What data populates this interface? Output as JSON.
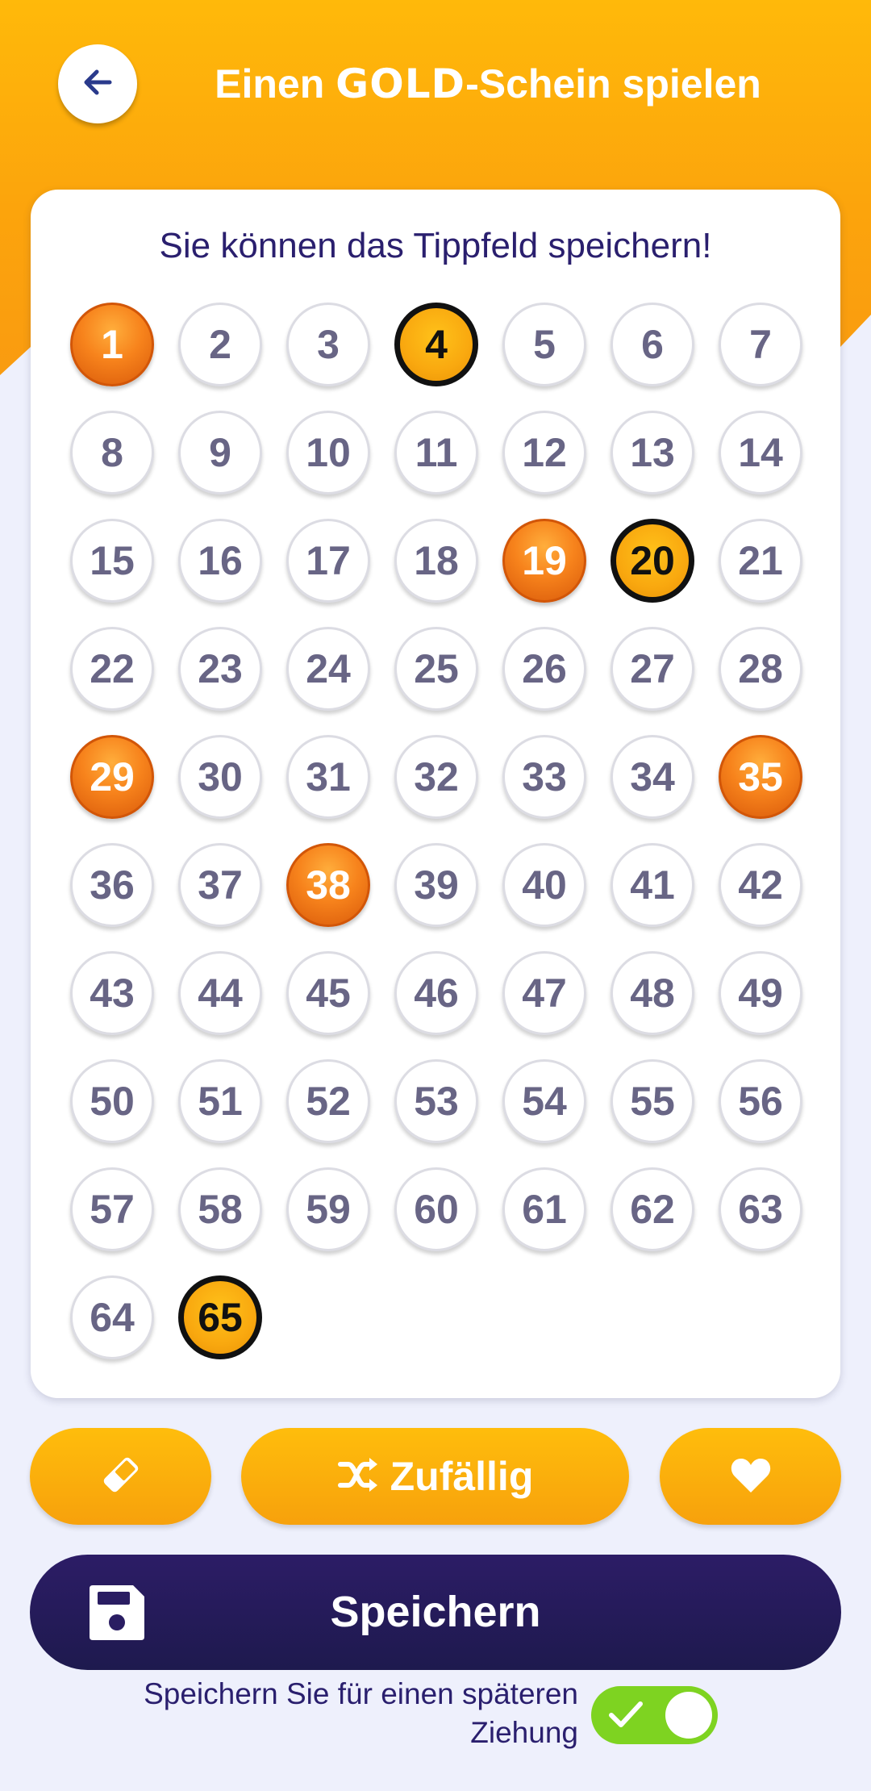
{
  "header": {
    "title_prefix": "Einen ",
    "title_brand": "GOLD",
    "title_suffix": "-Schein spielen"
  },
  "card": {
    "hint": "Sie können das Tippfeld speichern!",
    "numbers": [
      {
        "n": "1",
        "state": "orange"
      },
      {
        "n": "2",
        "state": "plain"
      },
      {
        "n": "3",
        "state": "plain"
      },
      {
        "n": "4",
        "state": "gold"
      },
      {
        "n": "5",
        "state": "plain"
      },
      {
        "n": "6",
        "state": "plain"
      },
      {
        "n": "7",
        "state": "plain"
      },
      {
        "n": "8",
        "state": "plain"
      },
      {
        "n": "9",
        "state": "plain"
      },
      {
        "n": "10",
        "state": "plain"
      },
      {
        "n": "11",
        "state": "plain"
      },
      {
        "n": "12",
        "state": "plain"
      },
      {
        "n": "13",
        "state": "plain"
      },
      {
        "n": "14",
        "state": "plain"
      },
      {
        "n": "15",
        "state": "plain"
      },
      {
        "n": "16",
        "state": "plain"
      },
      {
        "n": "17",
        "state": "plain"
      },
      {
        "n": "18",
        "state": "plain"
      },
      {
        "n": "19",
        "state": "orange"
      },
      {
        "n": "20",
        "state": "gold"
      },
      {
        "n": "21",
        "state": "plain"
      },
      {
        "n": "22",
        "state": "plain"
      },
      {
        "n": "23",
        "state": "plain"
      },
      {
        "n": "24",
        "state": "plain"
      },
      {
        "n": "25",
        "state": "plain"
      },
      {
        "n": "26",
        "state": "plain"
      },
      {
        "n": "27",
        "state": "plain"
      },
      {
        "n": "28",
        "state": "plain"
      },
      {
        "n": "29",
        "state": "orange"
      },
      {
        "n": "30",
        "state": "plain"
      },
      {
        "n": "31",
        "state": "plain"
      },
      {
        "n": "32",
        "state": "plain"
      },
      {
        "n": "33",
        "state": "plain"
      },
      {
        "n": "34",
        "state": "plain"
      },
      {
        "n": "35",
        "state": "orange"
      },
      {
        "n": "36",
        "state": "plain"
      },
      {
        "n": "37",
        "state": "plain"
      },
      {
        "n": "38",
        "state": "orange"
      },
      {
        "n": "39",
        "state": "plain"
      },
      {
        "n": "40",
        "state": "plain"
      },
      {
        "n": "41",
        "state": "plain"
      },
      {
        "n": "42",
        "state": "plain"
      },
      {
        "n": "43",
        "state": "plain"
      },
      {
        "n": "44",
        "state": "plain"
      },
      {
        "n": "45",
        "state": "plain"
      },
      {
        "n": "46",
        "state": "plain"
      },
      {
        "n": "47",
        "state": "plain"
      },
      {
        "n": "48",
        "state": "plain"
      },
      {
        "n": "49",
        "state": "plain"
      },
      {
        "n": "50",
        "state": "plain"
      },
      {
        "n": "51",
        "state": "plain"
      },
      {
        "n": "52",
        "state": "plain"
      },
      {
        "n": "53",
        "state": "plain"
      },
      {
        "n": "54",
        "state": "plain"
      },
      {
        "n": "55",
        "state": "plain"
      },
      {
        "n": "56",
        "state": "plain"
      },
      {
        "n": "57",
        "state": "plain"
      },
      {
        "n": "58",
        "state": "plain"
      },
      {
        "n": "59",
        "state": "plain"
      },
      {
        "n": "60",
        "state": "plain"
      },
      {
        "n": "61",
        "state": "plain"
      },
      {
        "n": "62",
        "state": "plain"
      },
      {
        "n": "63",
        "state": "plain"
      },
      {
        "n": "64",
        "state": "plain"
      },
      {
        "n": "65",
        "state": "gold"
      }
    ]
  },
  "actions": {
    "erase_icon": "eraser-icon",
    "random_icon": "shuffle-icon",
    "random_label": "Zufällig",
    "favorite_icon": "heart-icon"
  },
  "save": {
    "icon": "floppy-disk-icon",
    "label": "Speichern"
  },
  "later": {
    "text_line1": "Speichern Sie für einen späteren",
    "text_line2": "Ziehung",
    "toggle_on": true
  },
  "colors": {
    "header": "#fca40c",
    "orange_ball": "#f7831c",
    "gold_ball": "#f9a80f",
    "save_button": "#2c1c66",
    "toggle_on": "#7ed321",
    "text_dark": "#2a1f6e"
  }
}
